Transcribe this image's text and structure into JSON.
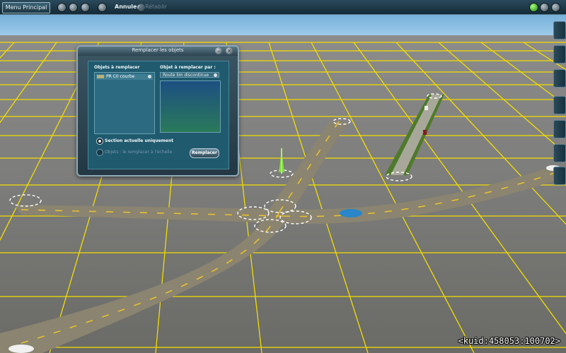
{
  "topbar": {
    "menu_label": "Menu Principal",
    "undo_label": "Annuler",
    "redo_label": "Rétablir"
  },
  "dialog": {
    "title": "Remplacer les objets",
    "left_header": "Objets à remplacer",
    "right_header": "Objet à remplacer par :",
    "left_item": "PR C0 courbe",
    "right_selected": "Route lim discontinue",
    "option_section": "Section actuelle uniquement",
    "option_other": "Objets : le remplacer à l'échelle",
    "replace_button": "Remplacer"
  },
  "status": {
    "kuid": "<kuid:458053:100702>"
  },
  "colors": {
    "sky": "#7fb8e0",
    "ground": "#7a7a78",
    "grid": "#f6e200",
    "road": "#8a8470",
    "road_line": "#e8c030",
    "ui_panel": "#1f5a6e"
  },
  "icons": {
    "top_left": [
      "camera-icon",
      "trash-icon",
      "paint-icon",
      "settings-icon"
    ],
    "top_right": [
      "green-status-icon",
      "add-icon",
      "up-arrow-icon"
    ],
    "right_toolbar": [
      "tree-icon",
      "grass-icon",
      "fence-icon",
      "track-icon",
      "wrench-icon",
      "layer-icon",
      "gear-icon"
    ]
  }
}
